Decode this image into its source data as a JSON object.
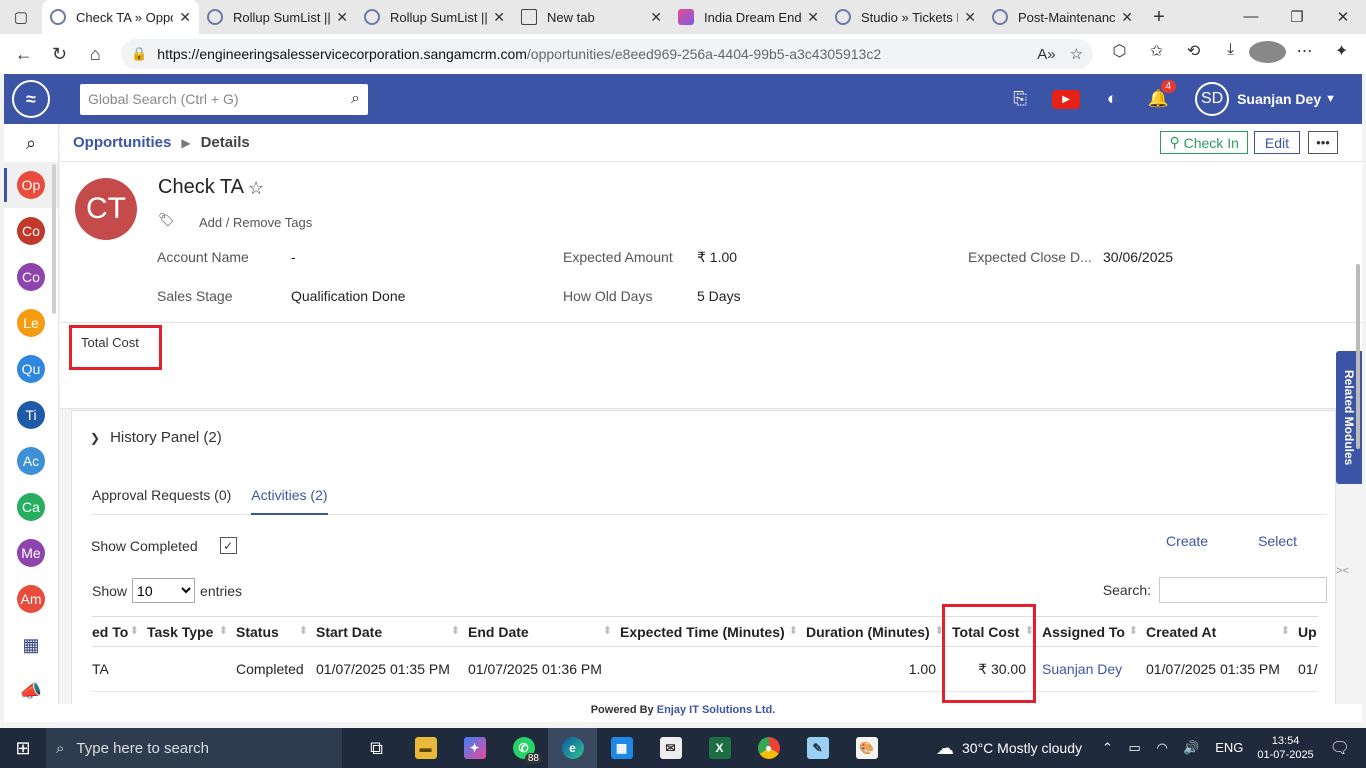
{
  "browser": {
    "tabs": [
      {
        "title": "Check TA » Oppor",
        "favicon": "crm-icon",
        "active": true
      },
      {
        "title": "Rollup SumList || S",
        "favicon": "crm-icon",
        "active": false
      },
      {
        "title": "Rollup SumList || S",
        "favicon": "crm-icon",
        "active": false
      },
      {
        "title": "New tab",
        "favicon": "newtab-icon",
        "active": false
      },
      {
        "title": "India Dream Ends",
        "favicon": "site-icon",
        "active": false
      },
      {
        "title": "Studio » Tickets F",
        "favicon": "crm-icon",
        "active": false
      },
      {
        "title": "Post-Maintenance",
        "favicon": "crm-icon",
        "active": false
      }
    ],
    "url_host": "https://engineeringsalesservicecorporation.sangamcrm.com",
    "url_path": "/opportunities/e8eed969-256a-4404-99b5-a3c4305913c2"
  },
  "app": {
    "search_placeholder": "Global Search (Ctrl + G)",
    "notification_count": "4",
    "user_initials": "SD",
    "user_name": "Suanjan Dey"
  },
  "sidebar": {
    "items": [
      {
        "label": "Op",
        "color": "#e74c3c",
        "name": "opportunities"
      },
      {
        "label": "Co",
        "color": "#c0392b",
        "name": "contacts"
      },
      {
        "label": "Co",
        "color": "#8e44ad",
        "name": "companies"
      },
      {
        "label": "Le",
        "color": "#f39c12",
        "name": "leads"
      },
      {
        "label": "Qu",
        "color": "#2e86de",
        "name": "quotes"
      },
      {
        "label": "Ti",
        "color": "#1e5aa8",
        "name": "tickets"
      },
      {
        "label": "Ac",
        "color": "#3d8fd6",
        "name": "activities"
      },
      {
        "label": "Ca",
        "color": "#27ae60",
        "name": "campaigns"
      },
      {
        "label": "Me",
        "color": "#8e44ad",
        "name": "meetings"
      },
      {
        "label": "Am",
        "color": "#e74c3c",
        "name": "amc"
      }
    ]
  },
  "breadcrumb": {
    "root": "Opportunities",
    "current": "Details",
    "check_in": "Check In",
    "edit": "Edit",
    "more": "•••"
  },
  "record": {
    "initials": "CT",
    "title": "Check TA",
    "tags_label": "Add / Remove Tags",
    "fields": {
      "account_name_label": "Account Name",
      "account_name_value": "-",
      "expected_amount_label": "Expected Amount",
      "expected_amount_value": "₹ 1.00",
      "expected_close_label": "Expected Close D...",
      "expected_close_value": "30/06/2025",
      "sales_stage_label": "Sales Stage",
      "sales_stage_value": "Qualification Done",
      "how_old_label": "How Old Days",
      "how_old_value": "5 Days"
    },
    "total_cost_label": "Total Cost"
  },
  "history": {
    "title": "History Panel (2)",
    "tabs": [
      "Approval Requests (0)",
      "Activities (2)"
    ],
    "show_completed": "Show Completed",
    "create": "Create",
    "select": "Select",
    "show": "Show",
    "entries": "entries",
    "page_size": "10",
    "search_label": "Search:",
    "columns": [
      "ed To",
      "Task Type",
      "Status",
      "Start Date",
      "End Date",
      "Expected Time (Minutes)",
      "Duration (Minutes)",
      "Total Cost",
      "Assigned To",
      "Created At",
      "Up"
    ],
    "row": {
      "related_to": "TA",
      "task_type": "",
      "status": "Completed",
      "start_date": "01/07/2025 01:35 PM",
      "end_date": "01/07/2025 01:36 PM",
      "expected_time": "",
      "duration": "1.00",
      "total_cost": "₹ 30.00",
      "assigned_to": "Suanjan Dey",
      "created_at": "01/07/2025 01:35 PM",
      "updated": "01/"
    }
  },
  "related_modules": "Related Modules",
  "footer": {
    "prefix": "Powered By",
    "brand": "Enjay IT Solutions Ltd."
  },
  "taskbar": {
    "search_placeholder": "Type here to search",
    "whatsapp_count": "88",
    "weather": "30°C  Mostly cloudy",
    "lang": "ENG",
    "time": "13:54",
    "date": "01-07-2025"
  }
}
